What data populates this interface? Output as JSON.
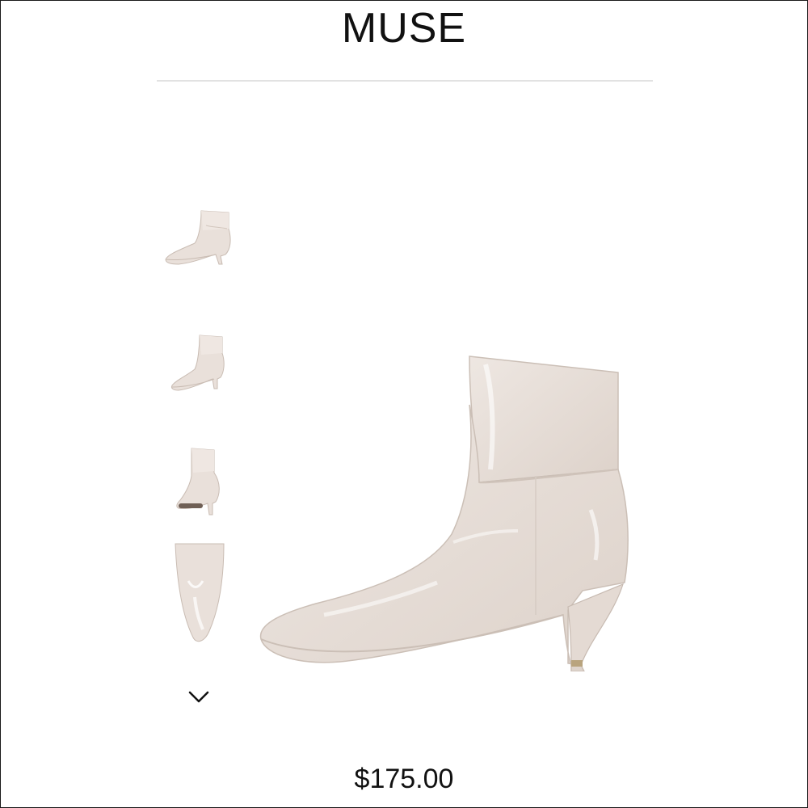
{
  "header": {
    "brand": "MUSE"
  },
  "product": {
    "price": "$175.00",
    "color_hex": "#e8dfd8"
  },
  "gallery": {
    "thumbnails": [
      {
        "view": "side-left"
      },
      {
        "view": "side-right"
      },
      {
        "view": "back-three-quarter"
      },
      {
        "view": "top-toe"
      }
    ],
    "more_icon": "chevron-down-icon"
  }
}
